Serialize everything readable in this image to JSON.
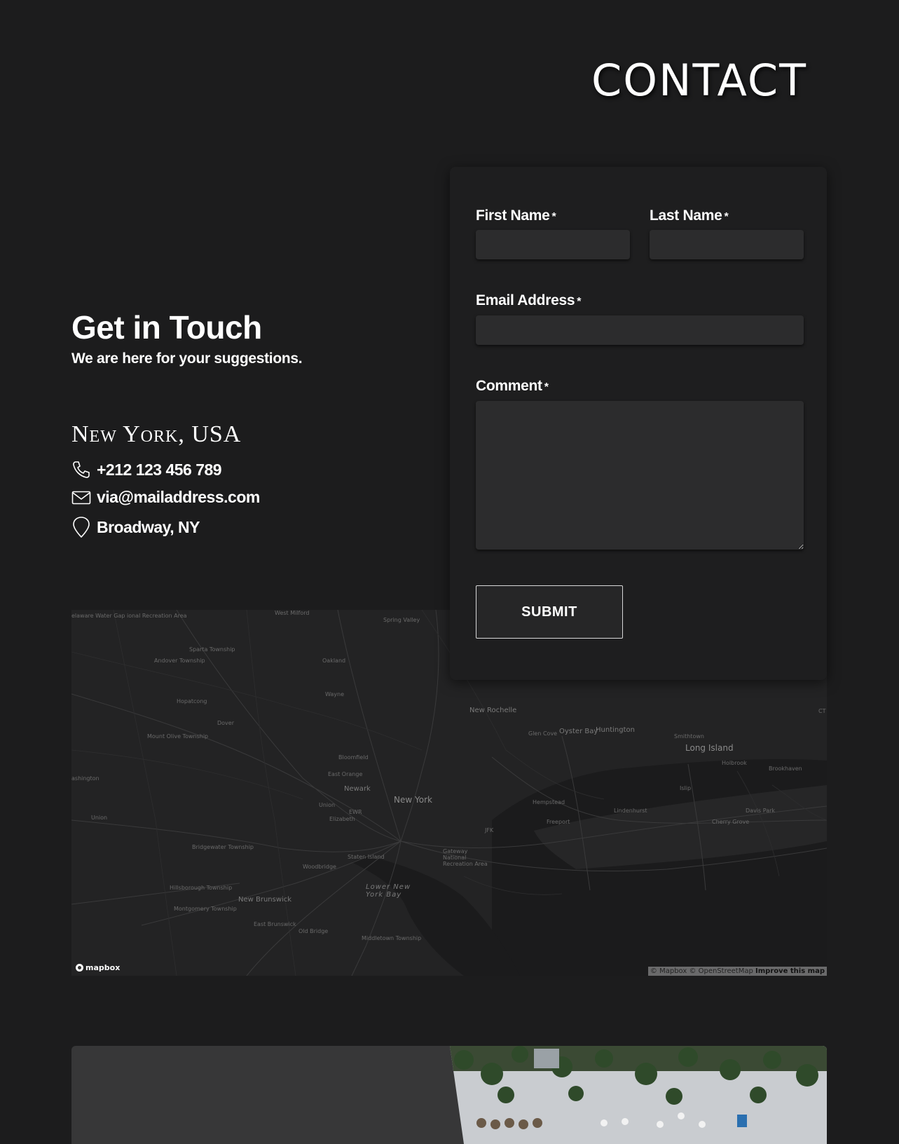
{
  "page": {
    "title": "CONTACT"
  },
  "info": {
    "heading": "Get in Touch",
    "subheading": "We are here for your suggestions.",
    "city": "New York, USA",
    "phone": "+212 123 456 789",
    "email": "via@mailaddress.com",
    "address": "Broadway, NY"
  },
  "form": {
    "first_name_label": "First Name",
    "last_name_label": "Last Name",
    "email_label": "Email Address",
    "comment_label": "Comment",
    "required_mark": "*",
    "first_name_value": "",
    "last_name_value": "",
    "email_value": "",
    "comment_value": "",
    "submit_label": "SUBMIT"
  },
  "map": {
    "labels": {
      "new_york": "New York",
      "long_island": "Long Island",
      "newark": "Newark",
      "new_rochelle": "New Rochelle",
      "oyster_bay": "Oyster Bay",
      "huntington": "Huntington",
      "glen_cove": "Glen Cove",
      "smithtown": "Smithtown",
      "holbrook": "Holbrook",
      "brookhaven": "Brookhaven",
      "islip": "Islip",
      "hempstead": "Hempstead",
      "freeport": "Freeport",
      "lindenhurst": "Lindenhurst",
      "davis_park": "Davis Park",
      "cherry_grove": "Cherry Grove",
      "jfk": "JFK",
      "ewr": "EWR",
      "elizabeth": "Elizabeth",
      "union_nj": "Union",
      "east_orange": "East Orange",
      "bloomfield": "Bloomfield",
      "wayne": "Wayne",
      "oakland": "Oakland",
      "spring_valley": "Spring Valley",
      "west_milford": "West Milford",
      "sparta": "Sparta Township",
      "andover": "Andover Township",
      "hopatcong": "Hopatcong",
      "dover": "Dover",
      "mount_olive": "Mount Olive Township",
      "washington": "ashington",
      "union": "Union",
      "bridgewater": "Bridgewater Township",
      "hillsborough": "Hillsborough Township",
      "montgomery": "Montgomery Township",
      "new_brunswick": "New Brunswick",
      "east_brunswick": "East Brunswick",
      "old_bridge": "Old Bridge",
      "middletown": "Middletown Township",
      "woodbridge": "Woodbridge",
      "staten_island": "Staten Island",
      "lower_new_york_bay": "Lower New York Bay",
      "gateway": "Gateway National Recreation Area",
      "delaware_gap": "elaware Water Gap ional Recreation Area",
      "ct": "CT"
    },
    "logo_text": "mapbox",
    "attribution_main": "© Mapbox © OpenStreetMap",
    "attribution_link": "Improve this map"
  },
  "colors": {
    "background": "#1c1c1d",
    "card": "#1e1e1f",
    "input": "#2c2c2d",
    "banner": "#373738"
  }
}
